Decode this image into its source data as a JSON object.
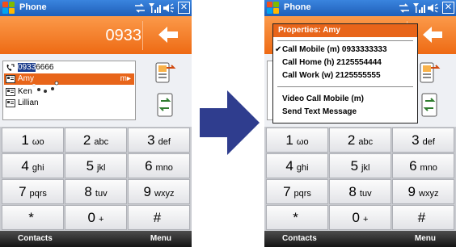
{
  "phone_title": "Phone",
  "dialed_number": "0933",
  "contacts": [
    {
      "prefix": "0933",
      "rest": "6666",
      "icon": "phone-call-icon"
    },
    {
      "name": "Amy",
      "indicator": "m▸",
      "icon": "contact-card-icon"
    },
    {
      "name": "Ken",
      "icon": "contact-card-icon"
    },
    {
      "name": "Lillian",
      "icon": "contact-card-icon"
    }
  ],
  "keys": [
    {
      "d": "1",
      "l": "ωο"
    },
    {
      "d": "2",
      "l": "abc"
    },
    {
      "d": "3",
      "l": "def"
    },
    {
      "d": "4",
      "l": "ghi"
    },
    {
      "d": "5",
      "l": "jkl"
    },
    {
      "d": "6",
      "l": "mno"
    },
    {
      "d": "7",
      "l": "pqrs"
    },
    {
      "d": "8",
      "l": "tuv"
    },
    {
      "d": "9",
      "l": "wxyz"
    },
    {
      "d": "*",
      "l": ""
    },
    {
      "d": "0",
      "l": "+"
    },
    {
      "d": "#",
      "l": ""
    }
  ],
  "softkeys": {
    "left": "Contacts",
    "right": "Menu"
  },
  "menu": {
    "header": "Properties: Amy",
    "items": [
      {
        "label": "Call Mobile (m) 0933333333",
        "checked": "✔"
      },
      {
        "label": "Call Home (h) 2125554444",
        "checked": ""
      },
      {
        "label": "Call Work (w) 2125555555",
        "checked": ""
      },
      {
        "label": "Video Call Mobile (m)",
        "checked": ""
      },
      {
        "label": "Send Text Message",
        "checked": ""
      }
    ]
  },
  "colors": {
    "accent": "#ee6a14",
    "titlebar": "#1f5fb8",
    "arrow": "#2f3d8e"
  }
}
